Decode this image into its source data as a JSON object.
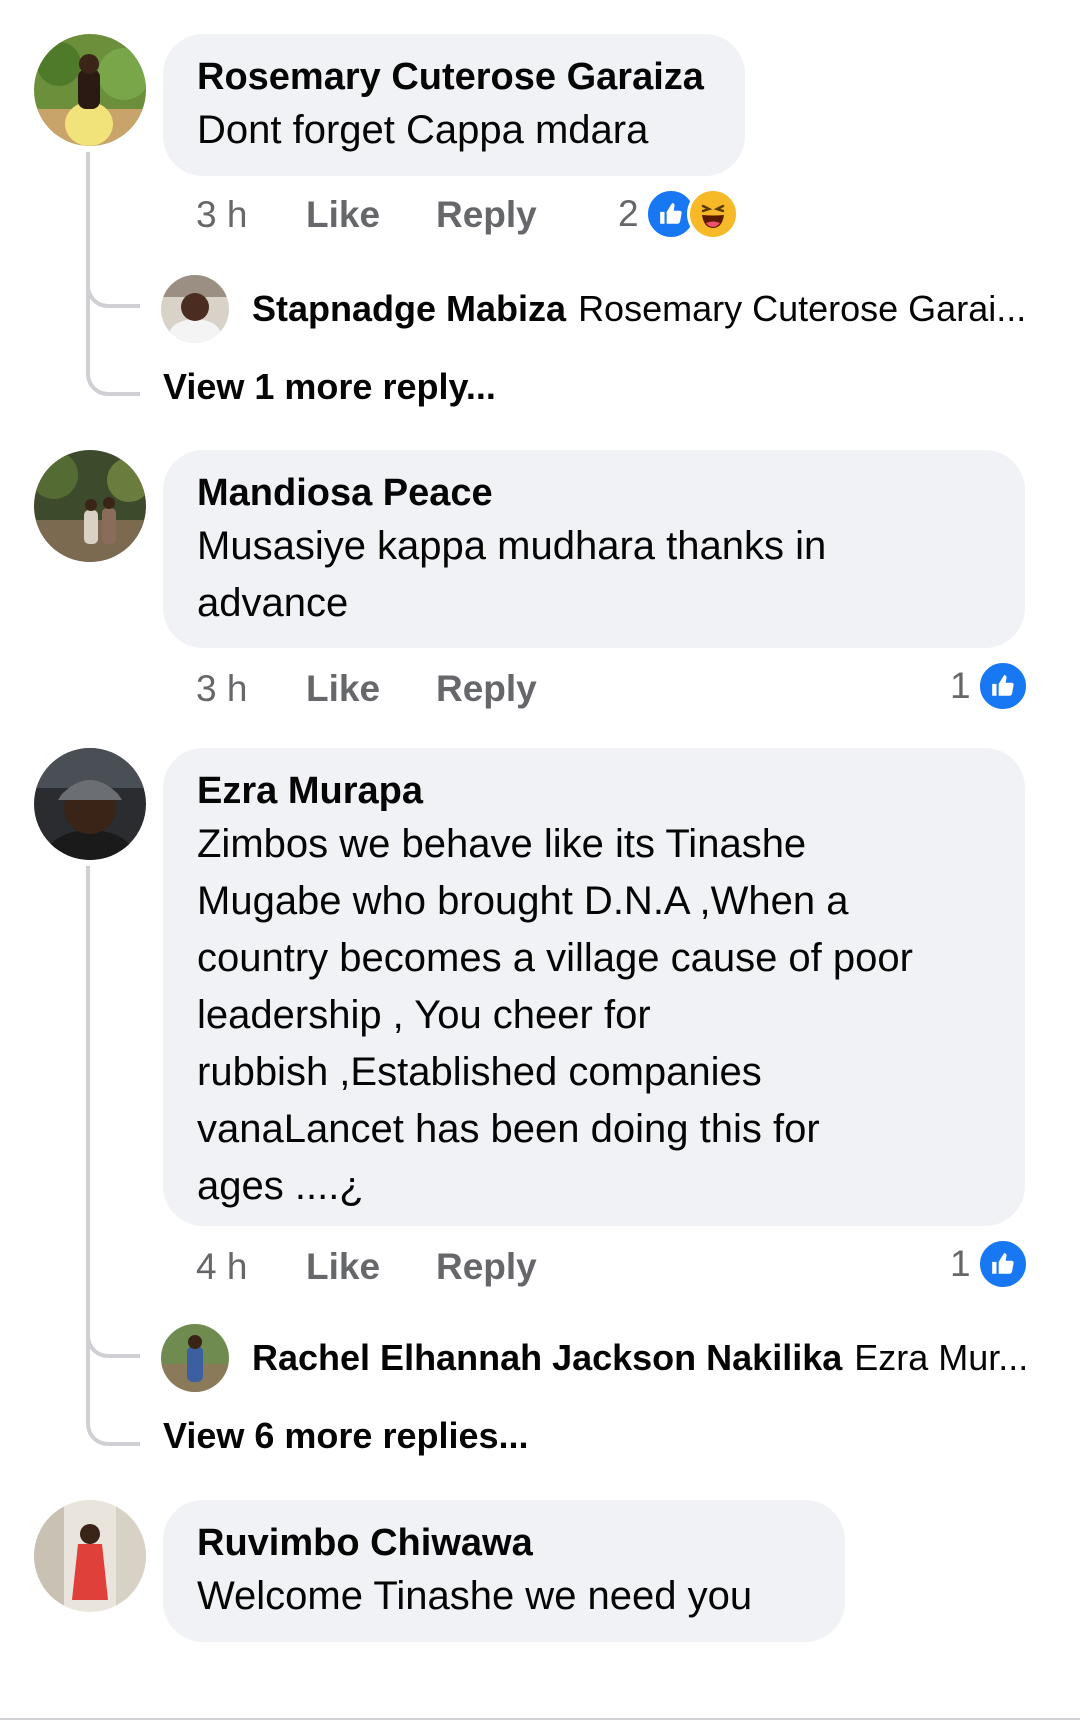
{
  "comments": [
    {
      "author": "Rosemary Cuterose Garaiza",
      "text": "Dont forget Cappa mdara",
      "time": "3 h",
      "like_label": "Like",
      "reply_label": "Reply",
      "reaction_count": "2",
      "reactions": [
        "like-icon",
        "haha-icon"
      ],
      "replies_preview": {
        "author": "Stapnadge Mabiza",
        "text": "Rosemary Cuterose Garai..."
      },
      "view_more": "View 1 more reply..."
    },
    {
      "author": "Mandiosa Peace",
      "text": "Musasiye kappa mudhara thanks in\nadvance",
      "time": "3 h",
      "like_label": "Like",
      "reply_label": "Reply",
      "reaction_count": "1",
      "reactions": [
        "like-icon"
      ]
    },
    {
      "author": "Ezra Murapa",
      "text": "Zimbos we behave like its Tinashe\nMugabe who brought D.N.A ,When a\ncountry becomes a village cause of poor\nleadership , You cheer for\nrubbish ,Established companies\nvanaLancet has been doing this for\nages ....¿",
      "time": "4 h",
      "like_label": "Like",
      "reply_label": "Reply",
      "reaction_count": "1",
      "reactions": [
        "like-icon"
      ],
      "replies_preview": {
        "author": "Rachel Elhannah Jackson Nakilika",
        "text": "Ezra Mur..."
      },
      "view_more": "View 6 more replies..."
    },
    {
      "author": "Ruvimbo Chiwawa",
      "text": "Welcome Tinashe we need you"
    }
  ],
  "colors": {
    "bubble": "#f0f2f5",
    "meta_text": "#65676b",
    "like_blue": "#1877f2",
    "haha_yellow": "#f7b928",
    "thread_line": "#ced0d4"
  }
}
